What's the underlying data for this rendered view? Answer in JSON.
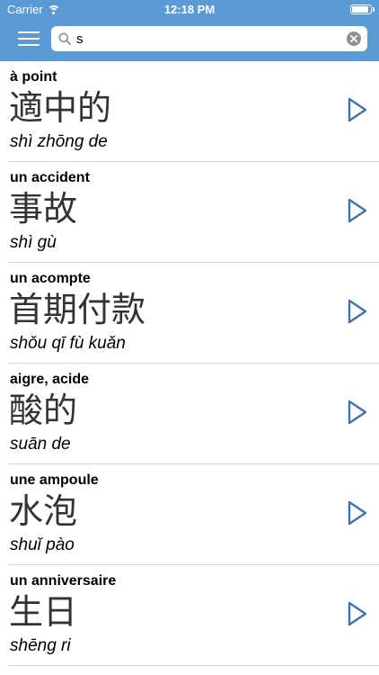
{
  "status_bar": {
    "carrier": "Carrier",
    "time": "12:18 PM",
    "battery_level": 0.9
  },
  "header": {
    "menu_icon": "hamburger-menu-icon",
    "search": {
      "value": "s",
      "placeholder": "",
      "icon": "search-icon",
      "clear_icon": "clear-icon"
    }
  },
  "results": [
    {
      "french": "à point",
      "chinese": "適中的",
      "pinyin": "shì zhōng de"
    },
    {
      "french": "un accident",
      "chinese": "事故",
      "pinyin": "shì gù"
    },
    {
      "french": "un acompte",
      "chinese": "首期付款",
      "pinyin": "shǒu qī fù kuǎn"
    },
    {
      "french": "aigre, acide",
      "chinese": "酸的",
      "pinyin": "suān de"
    },
    {
      "french": "une ampoule",
      "chinese": "水泡",
      "pinyin": "shuǐ pào"
    },
    {
      "french": "un anniversaire",
      "chinese": "生日",
      "pinyin": "shēng ri"
    }
  ],
  "colors": {
    "header_background": "#5b9bd5",
    "accent": "#3b73b9",
    "separator": "#d6d6d6"
  }
}
